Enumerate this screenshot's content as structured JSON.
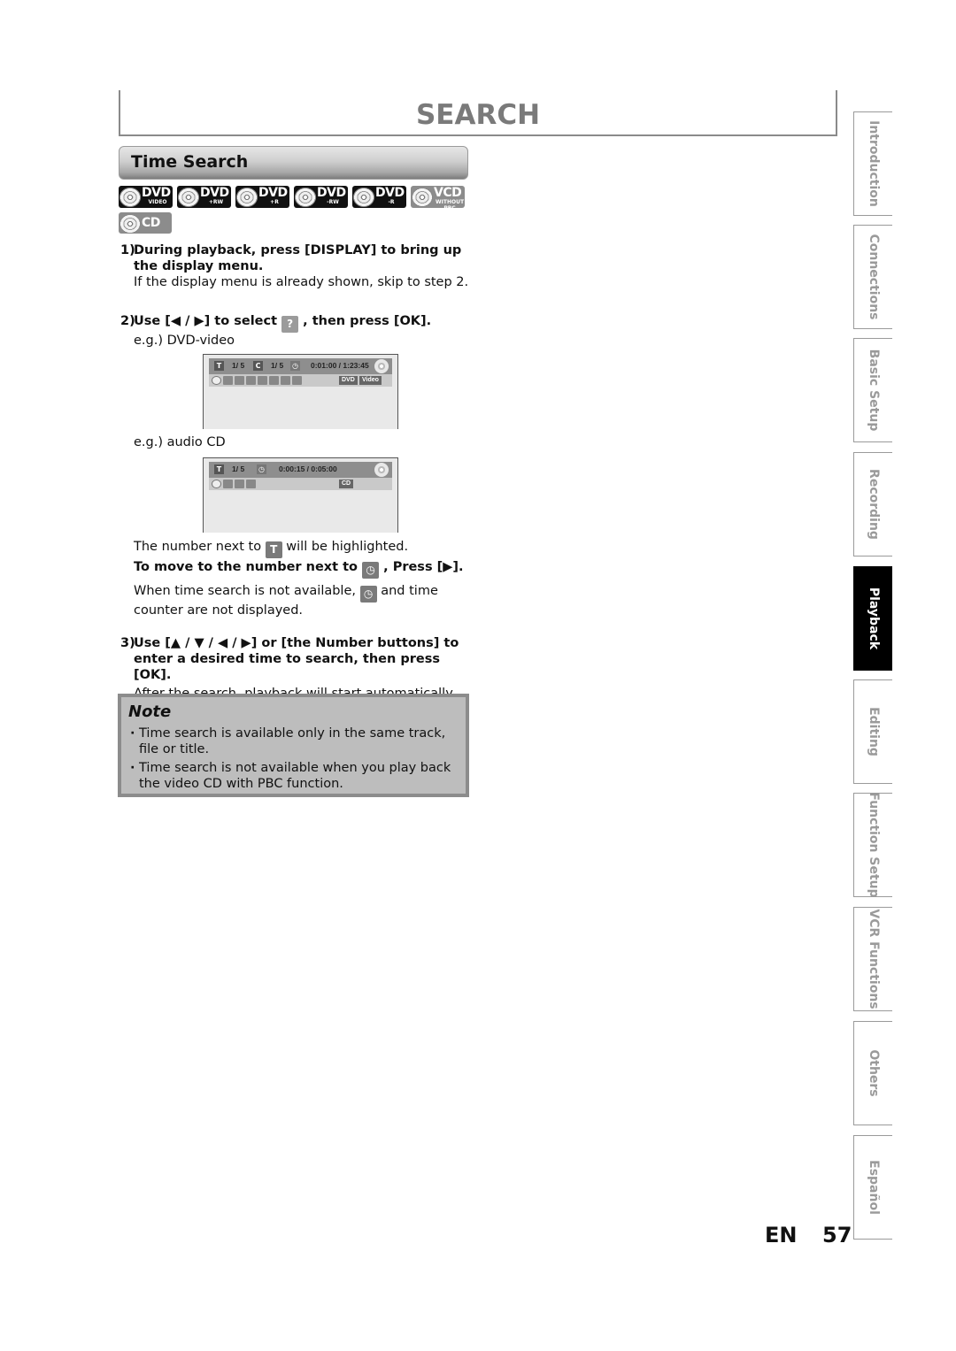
{
  "page": {
    "title": "SEARCH",
    "language_code": "EN",
    "page_number": "57"
  },
  "section": {
    "title": "Time Search"
  },
  "disc_badges": [
    {
      "main": "DVD",
      "sub": "VIDEO",
      "style": "black"
    },
    {
      "main": "DVD",
      "sub": "+RW",
      "style": "black"
    },
    {
      "main": "DVD",
      "sub": "+R",
      "style": "black"
    },
    {
      "main": "DVD",
      "sub": "-RW",
      "style": "black"
    },
    {
      "main": "DVD",
      "sub": "-R",
      "style": "black"
    },
    {
      "main": "VCD",
      "sub": "WITHOUT PBC",
      "style": "gray"
    },
    {
      "main": "CD",
      "sub": "",
      "style": "gray"
    }
  ],
  "steps": {
    "step1": {
      "num": "1)",
      "head": "During playback, press [DISPLAY] to bring up the display menu.",
      "body": "If the display menu is already shown, skip to step 2."
    },
    "step2": {
      "num": "2)",
      "head_before": "Use [◀ / ▶] to select",
      "head_after": ", then press [OK].",
      "eg_dvd": "e.g.) DVD-video",
      "eg_cd": "e.g.) audio CD",
      "highlight_before": "The number next to",
      "highlight_after": "will be highlighted.",
      "move_before": "To move to the number next to",
      "move_after": ", Press [▶].",
      "unavail_before": "When time search is not available,",
      "unavail_after": "and time counter are not displayed."
    },
    "step3": {
      "num": "3)",
      "head": "Use [▲ / ▼ / ◀ / ▶] or [the Number buttons] to enter a desired time to search, then press [OK].",
      "body": "After the search, playback will start automatically."
    }
  },
  "osd_dvd": {
    "title_icon": "T",
    "title_value": "1/  5",
    "chapter_icon": "C",
    "chapter_value": "1/  5",
    "time": "0:01:00 / 1:23:45",
    "tag1": "DVD",
    "tag2": "Video"
  },
  "osd_cd": {
    "title_icon": "T",
    "track_value": "1/  5",
    "time": "0:00:15 / 0:05:00",
    "tag1": "CD"
  },
  "icons": {
    "title_icon_text": "T",
    "search_icon": "search-icon",
    "clock_icon": "clock-icon"
  },
  "note": {
    "title": "Note",
    "items": [
      "Time search is available only in the same track, file or title.",
      "Time search is not available when you play back the video CD with PBC function."
    ]
  },
  "side_tabs": [
    {
      "label": "Introduction",
      "active": false
    },
    {
      "label": "Connections",
      "active": false
    },
    {
      "label": "Basic Setup",
      "active": false
    },
    {
      "label": "Recording",
      "active": false
    },
    {
      "label": "Playback",
      "active": true
    },
    {
      "label": "Editing",
      "active": false
    },
    {
      "label": "Function Setup",
      "active": false
    },
    {
      "label": "VCR Functions",
      "active": false
    },
    {
      "label": "Others",
      "active": false
    },
    {
      "label": "Español",
      "active": false
    }
  ]
}
